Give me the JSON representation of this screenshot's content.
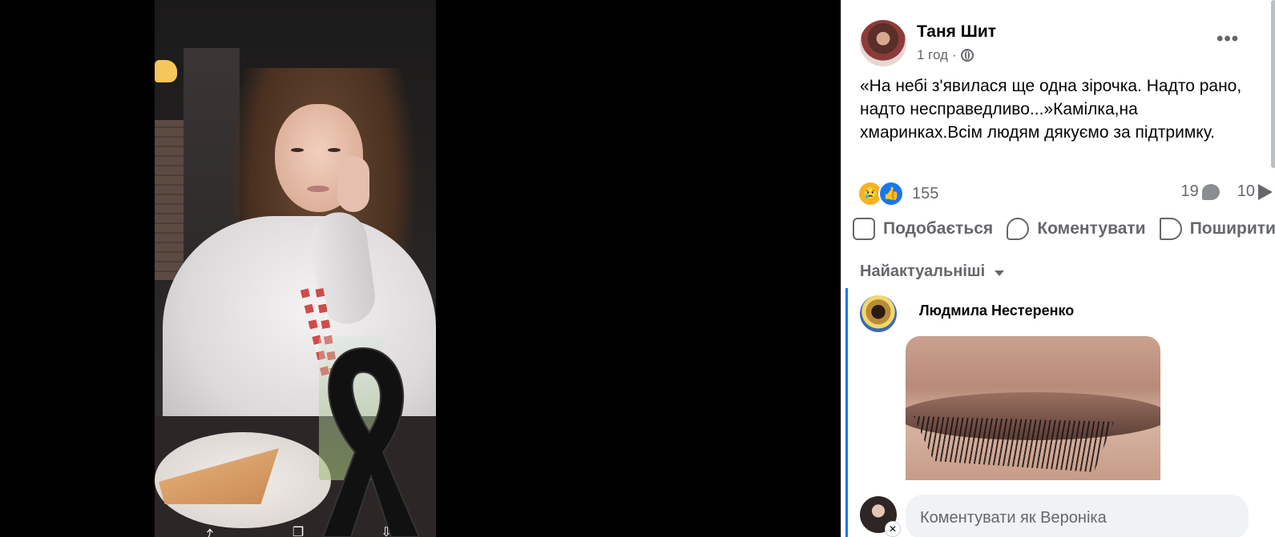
{
  "post": {
    "author": "Таня Шит",
    "time": "1 год",
    "separator": "·",
    "text": "«На небі з'явилася ще одна зірочка. Надто рано, надто несправедливо...»Камілка,на хмаринках.Всім людям дякуємо за підтримку.",
    "reaction_count": "155",
    "comment_count": "19",
    "share_count": "10",
    "icons": [
      "globe-icon",
      "more-icon",
      "sad-reaction-icon",
      "like-reaction-icon",
      "comment-icon",
      "share-icon",
      "like-icon"
    ]
  },
  "actions": {
    "like": "Подобається",
    "comment": "Коментувати",
    "share": "Поширити"
  },
  "comments": {
    "sort_label": "Найактуальніші",
    "items": [
      {
        "author": "Людмила Нестеренко"
      }
    ]
  },
  "composer": {
    "placeholder": "Коментувати як Вероніка"
  },
  "colors": {
    "accent": "#1877f2",
    "secondary_text": "#65676b",
    "viewer_bg": "#000000"
  }
}
